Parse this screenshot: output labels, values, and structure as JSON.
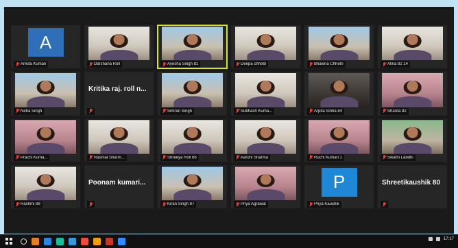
{
  "participants": [
    {
      "name": "Ankita Kumari",
      "type": "avatar",
      "letter": "A",
      "tone": "a"
    },
    {
      "name": "Darshana Roll",
      "type": "video",
      "tone": "light"
    },
    {
      "name": "Ayesha Singh 81",
      "type": "video",
      "tone": "blue",
      "active": true
    },
    {
      "name": "Deepa chhetri",
      "type": "video",
      "tone": "light"
    },
    {
      "name": "Bhawna Chhetri",
      "type": "video",
      "tone": "blue"
    },
    {
      "name": "Alina 82 14",
      "type": "video",
      "tone": "light"
    },
    {
      "name": "Neha Singh",
      "type": "video",
      "tone": "blue"
    },
    {
      "name": "Kritika raj. roll n...",
      "type": "text",
      "hide_label": true
    },
    {
      "name": "Simran Singh",
      "type": "video",
      "tone": "blue"
    },
    {
      "name": "Subhash Kuma...",
      "type": "video",
      "tone": "light"
    },
    {
      "name": "Arpita Sinha 84",
      "type": "video",
      "tone": "dark"
    },
    {
      "name": "Sharda 82",
      "type": "video",
      "tone": "pink"
    },
    {
      "name": "Prachi Kuma...",
      "type": "video",
      "tone": "pink"
    },
    {
      "name": "Rasmia Sharm...",
      "type": "video",
      "tone": "light"
    },
    {
      "name": "Shreeya Roll 86",
      "type": "video",
      "tone": "light"
    },
    {
      "name": "Aarohi Sharma",
      "type": "video",
      "tone": "light"
    },
    {
      "name": "Ruchi Kumari 1",
      "type": "video",
      "tone": "pink"
    },
    {
      "name": "Swathi Labdhi",
      "type": "video",
      "tone": "green"
    },
    {
      "name": "Rashmi 89",
      "type": "video",
      "tone": "light"
    },
    {
      "name": "Poonam kumari...",
      "type": "text",
      "hide_label": true
    },
    {
      "name": "Kiran Singh 87",
      "type": "video",
      "tone": "blue"
    },
    {
      "name": "Priya Agrawal",
      "type": "video",
      "tone": "pink"
    },
    {
      "name": "Priya Kaushik",
      "type": "avatar",
      "letter": "P",
      "tone": "p"
    },
    {
      "name": "Shreetikaushik 80",
      "type": "text",
      "hide_label": true
    }
  ],
  "taskbar": {
    "clock": "17:17"
  }
}
